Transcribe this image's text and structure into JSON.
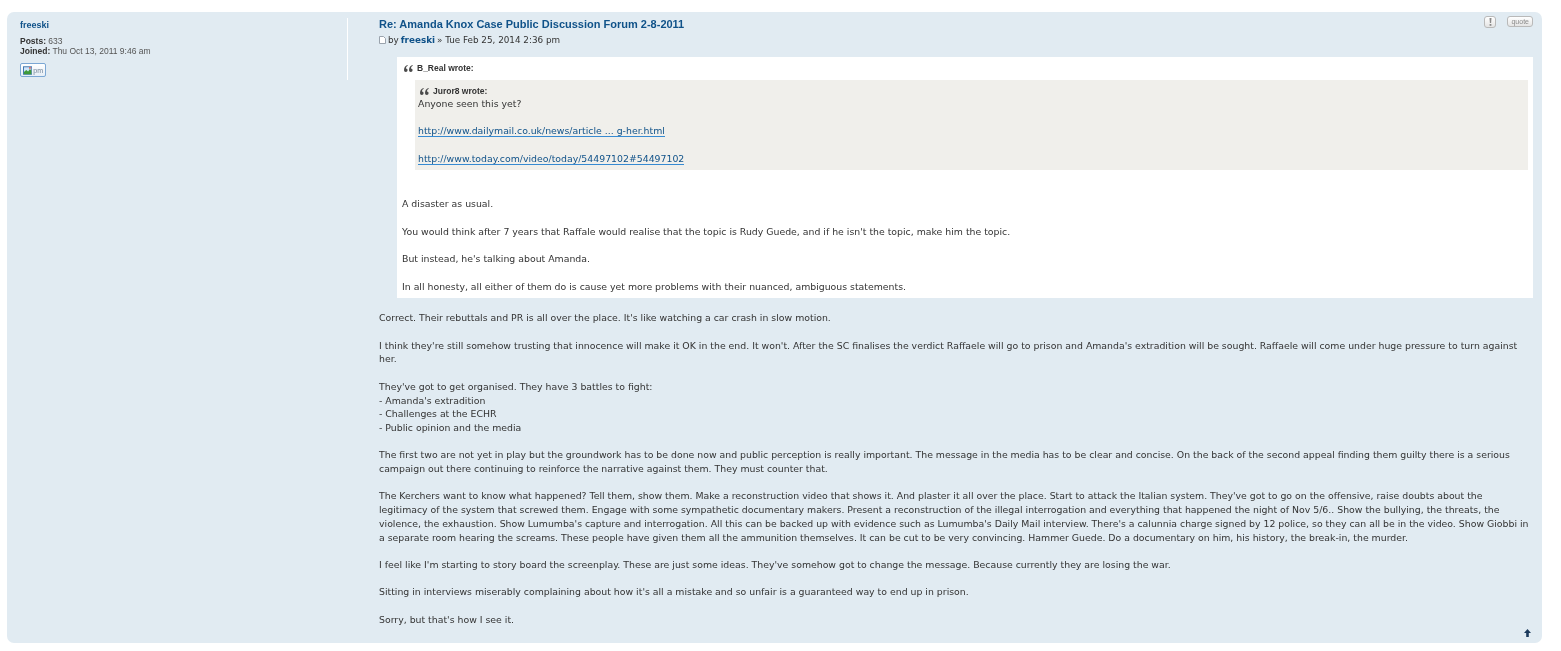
{
  "author": {
    "username": "freeski",
    "details": [
      {
        "label": "Posts:",
        "value": "633"
      },
      {
        "label": "Joined:",
        "value": "Thu Oct 13, 2011 9:46 am"
      }
    ],
    "pm_button": {
      "label": "pm"
    }
  },
  "post": {
    "title": "Re: Amanda Knox Case Public Discussion Forum 2-8-2011",
    "byline": {
      "prefix": "by",
      "author": "freeski",
      "date": "» Tue Feb 25, 2014 2:36 pm"
    },
    "buttons": [
      {
        "kind": "report"
      },
      {
        "kind": "quote",
        "label": "quote"
      }
    ],
    "quote": {
      "cite": "B_Real wrote:",
      "nested_quote": {
        "cite": "Juror8 wrote:",
        "content": [
          {
            "kind": "text",
            "text": "Anyone seen this yet?"
          },
          {
            "kind": "link",
            "text": "http://www.dailymail.co.uk/news/article ... g-her.html"
          },
          {
            "kind": "link",
            "text": "http://www.today.com/video/today/54497102#54497102"
          }
        ]
      },
      "paragraphs": [
        "A disaster as usual.",
        "You would think after 7 years that Raffale would realise that the topic is Rudy Guede, and if he isn't the topic, make him the topic.",
        "But instead, he's talking about Amanda.",
        "In all honesty, all either of them do is cause yet more problems with their nuanced, ambiguous statements."
      ]
    },
    "paragraphs": [
      {
        "kind": "text",
        "text": "Correct. Their rebuttals and PR is all over the place. It's like watching a car crash in slow motion."
      },
      {
        "kind": "text",
        "text": "I think they're still somehow trusting that innocence will make it OK in the end. It won't. After the SC finalises the verdict Raffaele will go to prison and Amanda's extradition will be sought. Raffaele will come under huge pressure to turn against her."
      },
      {
        "kind": "lines",
        "lines": [
          "They've got to get organised. They have 3 battles to fight:",
          "- Amanda's extradition",
          "- Challenges at the ECHR",
          "- Public opinion and the media"
        ]
      },
      {
        "kind": "text",
        "text": "The first two are not yet in play but the groundwork has to be done now and public perception is really important. The message in the media has to be clear and concise. On the back of the second appeal finding them guilty there is a serious campaign out there continuing to reinforce the narrative against them. They must counter that."
      },
      {
        "kind": "text",
        "text": "The Kerchers want to know what happened? Tell them, show them. Make a reconstruction video that shows it. And plaster it all over the place. Start to attack the Italian system. They've got to go on the offensive, raise doubts about the legitimacy of the system that screwed them. Engage with some sympathetic documentary makers. Present a reconstruction of the illegal interrogation and everything that happened the night of Nov 5/6.. Show the bullying, the threats, the violence, the exhaustion. Show Lumumba's capture and interrogation. All this can be backed up with evidence such as Lumumba's Daily Mail interview. There's a calunnia charge signed by 12 police, so they can all be in the video. Show Giobbi in a separate room hearing the screams. These people have given them all the ammunition themselves. It can be cut to be very convincing. Hammer Guede. Do a documentary on him, his history, the break-in, the murder."
      },
      {
        "kind": "text",
        "text": "I feel like I'm starting to story board the screenplay. These are just some ideas. They've somehow got to change the message. Because currently they are losing the war."
      },
      {
        "kind": "text",
        "text": "Sitting in interviews miserably complaining about how it's all a mistake and so unfair is a guaranteed way to end up in prison."
      },
      {
        "kind": "text",
        "text": "Sorry, but that's how I see it."
      }
    ]
  }
}
